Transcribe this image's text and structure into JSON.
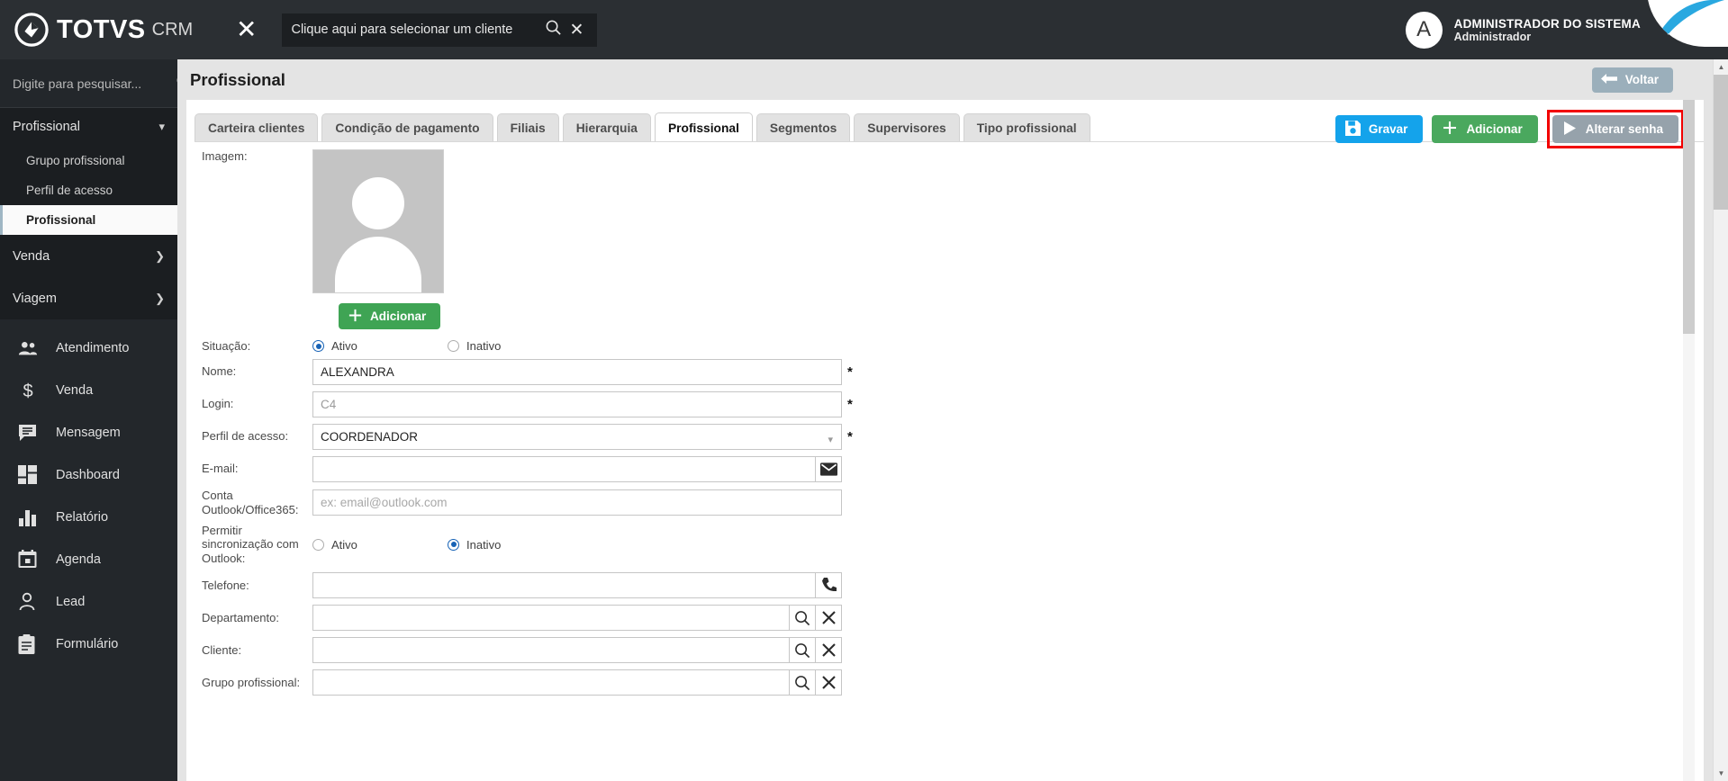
{
  "topbar": {
    "brand_name": "TOTVS",
    "brand_suffix": "CRM",
    "close_icon": "close-icon",
    "client_selector_text": "Clique aqui para selecionar um cliente",
    "client_search_icon": "search-icon",
    "client_clear_icon": "close-icon",
    "user_initial": "A",
    "user_name": "ADMINISTRADOR DO SISTEMA",
    "user_role": "Administrador",
    "user_caret_icon": "chevron-down-icon",
    "help_icon": "eye-icon"
  },
  "sidebar": {
    "search_placeholder": "Digite para pesquisar...",
    "search_icon": "search-icon",
    "group": {
      "label": "Profissional",
      "caret_icon": "chevron-down-icon",
      "subitems": [
        {
          "label": "Grupo profissional",
          "active": false
        },
        {
          "label": "Perfil de acesso",
          "active": false
        },
        {
          "label": "Profissional",
          "active": true
        }
      ]
    },
    "nav_rows": [
      {
        "label": "Venda",
        "caret_icon": "chevron-right-icon"
      },
      {
        "label": "Viagem",
        "caret_icon": "chevron-right-icon"
      }
    ],
    "icon_items": [
      {
        "label": "Atendimento",
        "icon": "people-icon"
      },
      {
        "label": "Venda",
        "icon": "dollar-icon"
      },
      {
        "label": "Mensagem",
        "icon": "chat-icon"
      },
      {
        "label": "Dashboard",
        "icon": "dashboard-grid-icon"
      },
      {
        "label": "Relatório",
        "icon": "bar-chart-icon"
      },
      {
        "label": "Agenda",
        "icon": "calendar-icon"
      },
      {
        "label": "Lead",
        "icon": "person-icon"
      },
      {
        "label": "Formulário",
        "icon": "clipboard-icon"
      }
    ]
  },
  "page": {
    "title": "Profissional",
    "back_label": "Voltar",
    "back_icon": "arrow-left-icon"
  },
  "tabs": [
    {
      "label": "Carteira clientes",
      "active": false
    },
    {
      "label": "Condição de pagamento",
      "active": false
    },
    {
      "label": "Filiais",
      "active": false
    },
    {
      "label": "Hierarquia",
      "active": false
    },
    {
      "label": "Profissional",
      "active": true
    },
    {
      "label": "Segmentos",
      "active": false
    },
    {
      "label": "Supervisores",
      "active": false
    },
    {
      "label": "Tipo profissional",
      "active": false
    }
  ],
  "actions": {
    "save_label": "Gravar",
    "save_icon": "save-icon",
    "add_label": "Adicionar",
    "add_icon": "plus-icon",
    "change_password_label": "Alterar senha",
    "change_password_icon": "play-icon",
    "highlight_color": "#f20000"
  },
  "form": {
    "image_label": "Imagem:",
    "add_photo_label": "Adicionar",
    "add_photo_icon": "plus-icon",
    "avatar_placeholder_icon": "user-avatar-placeholder-icon",
    "situacao": {
      "label": "Situação:",
      "option_active": "Ativo",
      "option_inactive": "Inativo",
      "selected": "Ativo"
    },
    "nome": {
      "label": "Nome:",
      "value": "ALEXANDRA",
      "required": "*"
    },
    "login": {
      "label": "Login:",
      "value": "C4",
      "required": "*"
    },
    "perfil_acesso": {
      "label": "Perfil de acesso:",
      "value": "COORDENADOR",
      "required": "*",
      "caret_icon": "chevron-down-icon"
    },
    "email": {
      "label": "E-mail:",
      "value": "",
      "icon": "envelope-icon"
    },
    "conta_outlook": {
      "label": "Conta Outlook/Office365:",
      "value": "",
      "placeholder": "ex: email@outlook.com"
    },
    "sync_outlook": {
      "label": "Permitir sincronização com Outlook:",
      "option_active": "Ativo",
      "option_inactive": "Inativo",
      "selected": "Inativo"
    },
    "telefone": {
      "label": "Telefone:",
      "value": "",
      "icon": "phone-icon"
    },
    "departamento": {
      "label": "Departamento:",
      "value": "",
      "search_icon": "search-icon",
      "clear_icon": "close-icon"
    },
    "cliente": {
      "label": "Cliente:",
      "value": "",
      "search_icon": "search-icon",
      "clear_icon": "close-icon"
    },
    "grupo_profissional": {
      "label": "Grupo profissional:",
      "value": "",
      "search_icon": "search-icon",
      "clear_icon": "close-icon"
    }
  },
  "scrollbar": {
    "up_icon": "chevron-up-icon",
    "down_icon": "chevron-down-icon"
  }
}
